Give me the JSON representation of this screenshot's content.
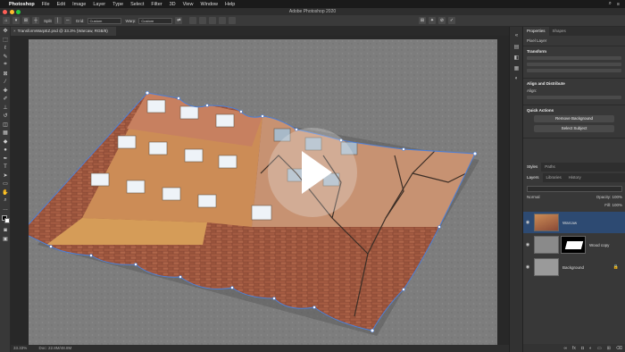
{
  "menubar": {
    "apple": "",
    "app": "Photoshop",
    "items": [
      "File",
      "Edit",
      "Image",
      "Layer",
      "Type",
      "Select",
      "Filter",
      "3D",
      "View",
      "Window",
      "Help"
    ]
  },
  "window": {
    "title": "Adobe Photoshop 2020"
  },
  "options": {
    "split_label": "Split",
    "grid_label": "Grid:",
    "grid_value": "Custom",
    "warp_label": "Warp:",
    "warp_value": "Custom"
  },
  "document": {
    "tab_label": "TransformWarpEZ.psd @ 33.3% (Warcaw, RGB/8)",
    "zoom": "33.33%",
    "doc_info": "Doc: 22.8M/48.8M"
  },
  "panels": {
    "top_tabs": [
      "Properties",
      "Shapes"
    ],
    "pixel_layer": "Pixel Layer",
    "transform_head": "Transform",
    "align_head": "Align and Distribute",
    "align_sub": "Align:",
    "quick_head": "Quick Actions",
    "remove_bg": "Remove Background",
    "select_subject": "Select Subject",
    "mid_tabs": [
      "Styles",
      "Paths"
    ],
    "layers_tabs": [
      "Layers",
      "Libraries",
      "History"
    ],
    "blend_mode": "Normal",
    "opacity": "Opacity: 100%",
    "fill": "Fill: 100%",
    "layers": [
      {
        "name": "Warcaw"
      },
      {
        "name": "Wood copy"
      },
      {
        "name": "Background"
      }
    ]
  },
  "colors": {
    "accent": "#2d4a72",
    "warp_line": "#4e7fd6",
    "canvas_bg": "#7a7a7a"
  }
}
